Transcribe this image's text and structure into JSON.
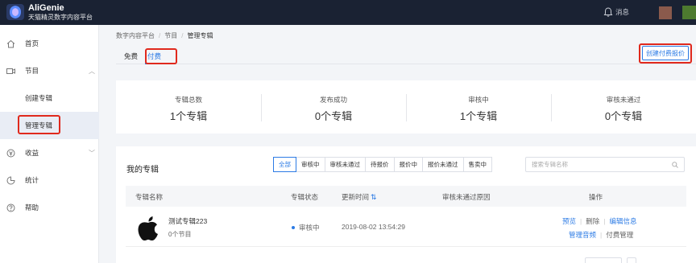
{
  "app": {
    "brand_name": "AliGenie",
    "brand_subtitle": "天猫精灵数字内容平台",
    "messages_label": "消息"
  },
  "sidebar": {
    "items": [
      {
        "label": "首页",
        "icon": "home-icon"
      },
      {
        "label": "节目",
        "icon": "video-icon",
        "expanded": true
      },
      {
        "label": "创建专辑"
      },
      {
        "label": "管理专辑",
        "active": true
      },
      {
        "label": "收益",
        "icon": "money-icon"
      },
      {
        "label": "统计",
        "icon": "pie-chart-icon"
      },
      {
        "label": "帮助",
        "icon": "help-icon"
      }
    ]
  },
  "breadcrumb": [
    "数字内容平台",
    "节目",
    "管理专辑"
  ],
  "tabs": [
    {
      "label": "免费"
    },
    {
      "label": "付费",
      "active": true
    }
  ],
  "create_button": "创建付费报价",
  "stats": [
    {
      "title": "专辑总数",
      "value": "1个专辑"
    },
    {
      "title": "发布成功",
      "value": "0个专辑"
    },
    {
      "title": "审核中",
      "value": "1个专辑"
    },
    {
      "title": "审核未通过",
      "value": "0个专辑"
    }
  ],
  "albums": {
    "title": "我的专辑",
    "filters": [
      "全部",
      "审核中",
      "审核未通过",
      "待报价",
      "报价中",
      "报价未通过",
      "售卖中"
    ],
    "active_filter": "全部",
    "search_placeholder": "搜索专辑名称",
    "columns": [
      "专辑名称",
      "专辑状态",
      "更新时间",
      "审核未通过原因",
      "操作"
    ],
    "rows": [
      {
        "name": "测试专辑223",
        "programs": "0个节目",
        "status": "审核中",
        "updated": "2019-08-02 13:54:29",
        "reason": "",
        "actions_line1": [
          "预览",
          "删除",
          "编辑信息"
        ],
        "actions_line2": [
          "管理音频",
          "付费管理"
        ]
      }
    ]
  },
  "colors": {
    "accent": "#2c7be5",
    "topbar": "#1a2233",
    "highlight": "#e0291d"
  }
}
